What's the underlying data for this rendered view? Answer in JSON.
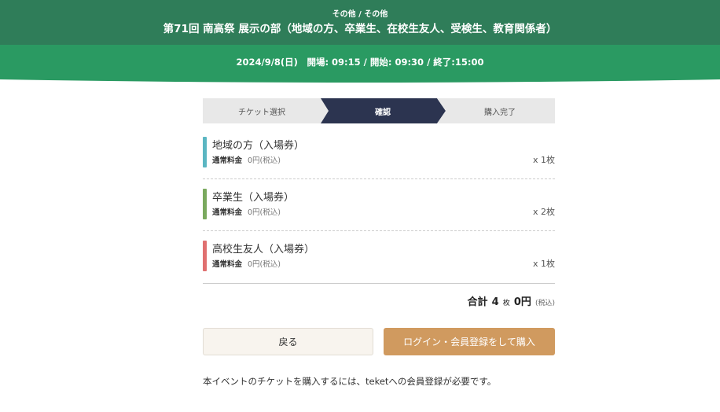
{
  "header": {
    "category": "その他 / その他",
    "title": "第71回 南高祭 展示の部（地域の方、卒業生、在校生友人、受検生、教育関係者）",
    "schedule": "2024/9/8(日)　開場: 09:15 / 開始: 09:30 / 終了:15:00"
  },
  "steps": [
    {
      "label": "チケット選択",
      "state": "done"
    },
    {
      "label": "確認",
      "state": "active"
    },
    {
      "label": "購入完了",
      "state": "pending"
    }
  ],
  "tickets": [
    {
      "name": "地域の方（入場券）",
      "price_label": "通常料金",
      "price": "0円(税込)",
      "quantity": "x 1枚",
      "color": "#5bb6c2"
    },
    {
      "name": "卒業生（入場券）",
      "price_label": "通常料金",
      "price": "0円(税込)",
      "quantity": "x 2枚",
      "color": "#7aa95e"
    },
    {
      "name": "高校生友人（入場券）",
      "price_label": "通常料金",
      "price": "0円(税込)",
      "quantity": "x 1枚",
      "color": "#e07070"
    }
  ],
  "total": {
    "label": "合計",
    "count": "4",
    "count_unit": "枚",
    "amount": "0円",
    "tax_note": "(税込)"
  },
  "buttons": {
    "back": "戻る",
    "purchase": "ログイン・会員登録をして購入"
  },
  "notice": "本イベントのチケットを購入するには、teketへの会員登録が必要です。",
  "colors": {
    "header_dark": "#2f7d59",
    "header_light": "#2a9a62",
    "step_active": "#2c3450",
    "step_inactive": "#e8e8e8",
    "purchase_button": "#d09a5f"
  }
}
